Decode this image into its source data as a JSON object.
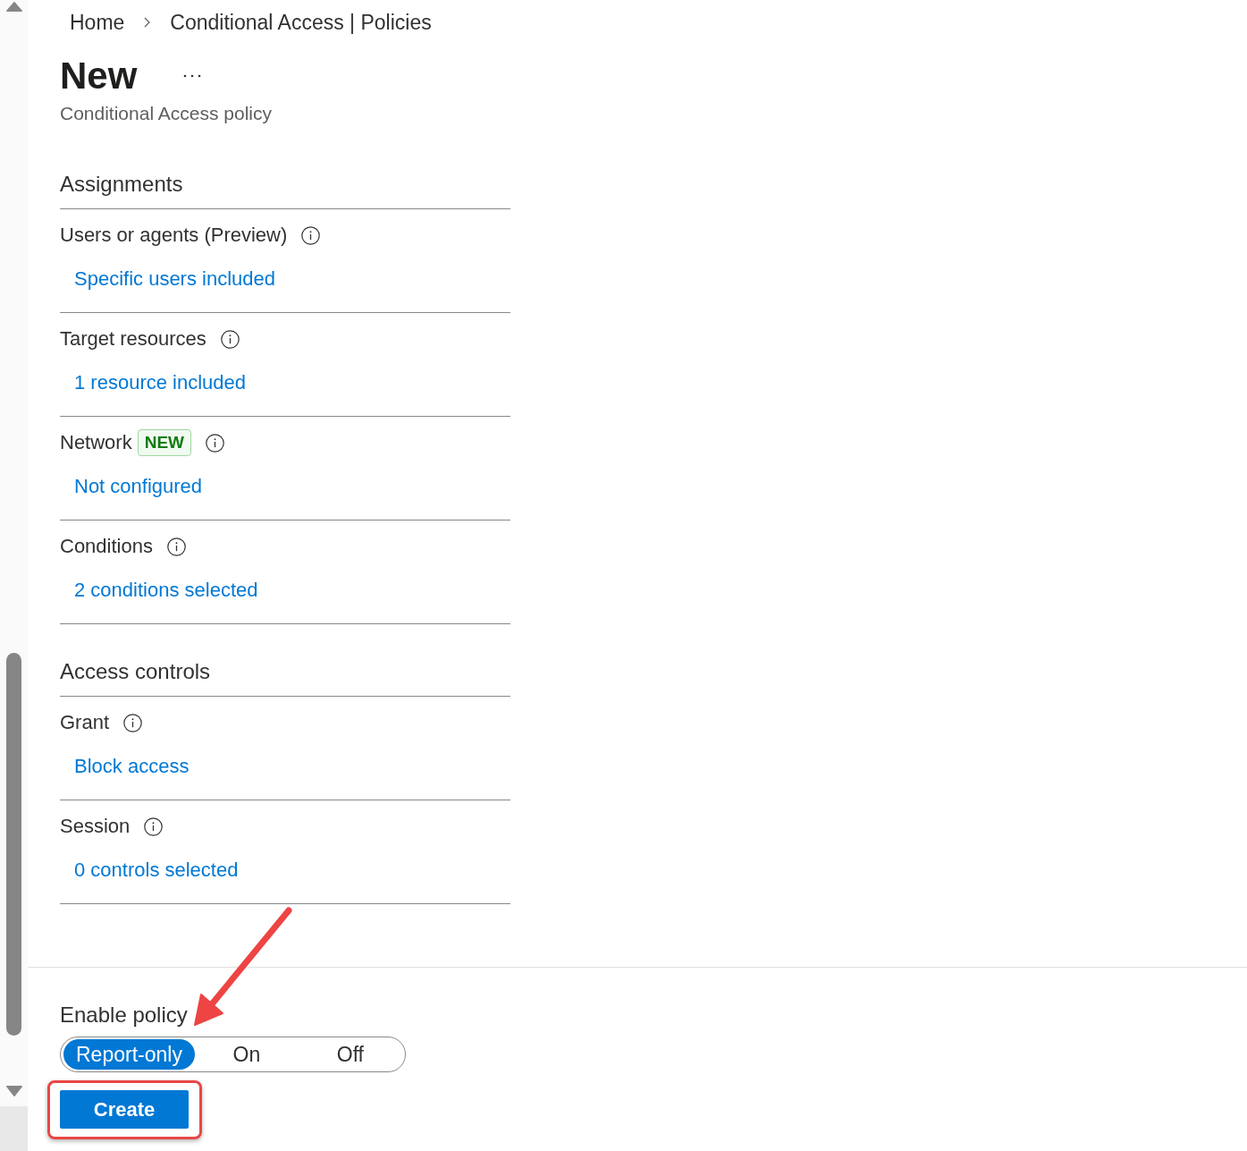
{
  "breadcrumb": [
    {
      "label": "Home"
    },
    {
      "label": "Conditional Access | Policies"
    }
  ],
  "header": {
    "title": "New",
    "subtitle": "Conditional Access policy"
  },
  "sections": [
    {
      "heading": "Assignments",
      "items": [
        {
          "label": "Users or agents (Preview)",
          "value": "Specific users included"
        },
        {
          "label": "Target resources",
          "value": "1 resource included"
        },
        {
          "label": "Network",
          "badge": "NEW",
          "value": "Not configured"
        },
        {
          "label": "Conditions",
          "value": "2 conditions selected"
        }
      ]
    },
    {
      "heading": "Access controls",
      "items": [
        {
          "label": "Grant",
          "value": "Block access"
        },
        {
          "label": "Session",
          "value": "0 controls selected"
        }
      ]
    }
  ],
  "enable_policy": {
    "label": "Enable policy",
    "options": [
      {
        "label": "Report-only",
        "selected": true
      },
      {
        "label": "On",
        "selected": false
      },
      {
        "label": "Off",
        "selected": false
      }
    ]
  },
  "create_button": {
    "label": "Create",
    "highlighted": true
  },
  "annotations": [
    {
      "kind": "arrow"
    }
  ]
}
